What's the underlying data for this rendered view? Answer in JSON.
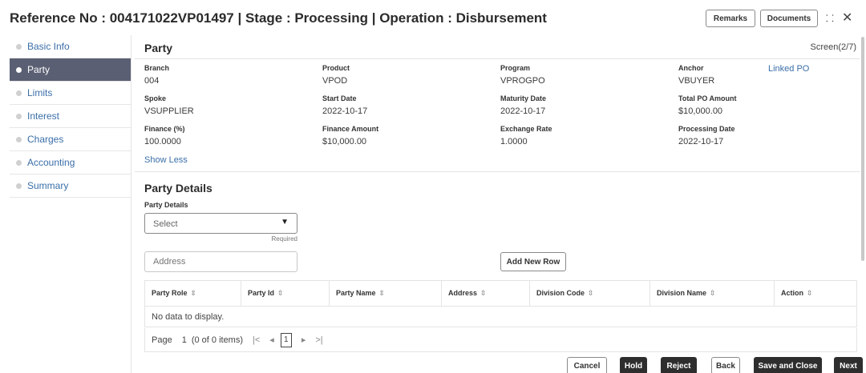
{
  "header": {
    "title": "Reference No : 004171022VP01497 | Stage : Processing | Operation : Disbursement",
    "remarks_label": "Remarks",
    "documents_label": "Documents",
    "maximize_icon": "⸬",
    "close_icon": "✕"
  },
  "sidebar": {
    "items": [
      {
        "label": "Basic Info"
      },
      {
        "label": "Party"
      },
      {
        "label": "Limits"
      },
      {
        "label": "Interest"
      },
      {
        "label": "Charges"
      },
      {
        "label": "Accounting"
      },
      {
        "label": "Summary"
      }
    ],
    "active_index": 1
  },
  "section": {
    "title": "Party",
    "screen": "Screen(2/7)"
  },
  "summary": {
    "branch_label": "Branch",
    "branch": "004",
    "product_label": "Product",
    "product": "VPOD",
    "program_label": "Program",
    "program": "VPROGPO",
    "anchor_label": "Anchor",
    "anchor": "VBUYER",
    "linked_po": "Linked PO",
    "spoke_label": "Spoke",
    "spoke": "VSUPPLIER",
    "start_date_label": "Start Date",
    "start_date": "2022-10-17",
    "maturity_date_label": "Maturity Date",
    "maturity_date": "2022-10-17",
    "total_po_label": "Total PO Amount",
    "total_po": "$10,000.00",
    "finance_pct_label": "Finance (%)",
    "finance_pct": "100.0000",
    "finance_amount_label": "Finance Amount",
    "finance_amount": "$10,000.00",
    "exchange_rate_label": "Exchange Rate",
    "exchange_rate": "1.0000",
    "processing_date_label": "Processing Date",
    "processing_date": "2022-10-17",
    "show_less": "Show Less"
  },
  "party_details": {
    "title": "Party Details",
    "field_label": "Party Details",
    "select_value": "Select",
    "required": "Required",
    "address_placeholder": "Address",
    "add_row_label": "Add New Row"
  },
  "table": {
    "columns": [
      "Party Role",
      "Party Id",
      "Party Name",
      "Address",
      "Division Code",
      "Division Name",
      "Action"
    ],
    "sort_icon": "⇳",
    "empty": "No data to display."
  },
  "pager": {
    "page_label": "Page",
    "page_number": "1",
    "count": "(0 of 0 items)",
    "first": "|<",
    "prev": "◂",
    "current": "1",
    "next": "▸",
    "last": ">|"
  },
  "footer": {
    "cancel": "Cancel",
    "hold": "Hold",
    "reject": "Reject",
    "back": "Back",
    "save_close": "Save and Close",
    "next": "Next"
  }
}
